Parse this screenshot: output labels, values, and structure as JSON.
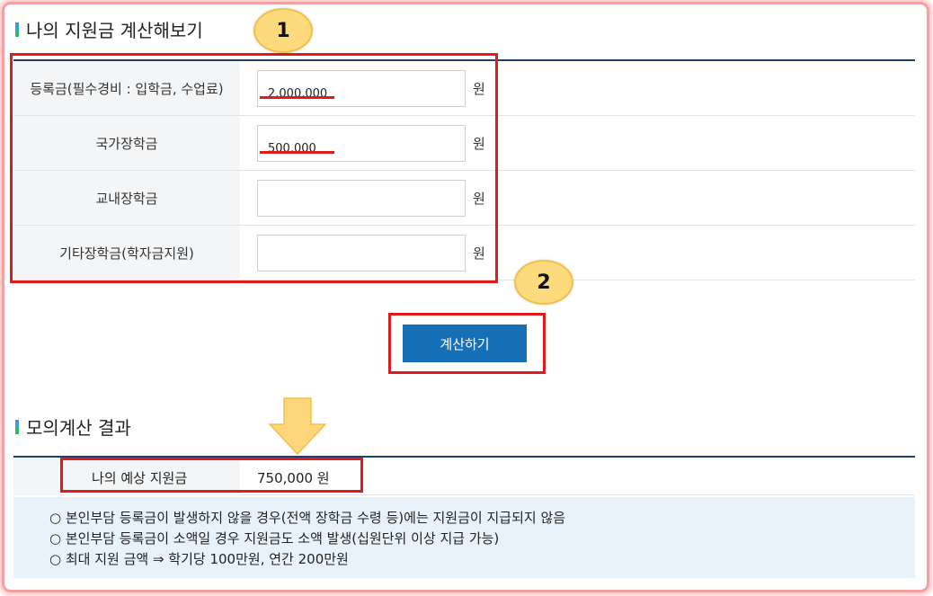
{
  "calculator": {
    "title": "나의 지원금 계산해보기",
    "rows": [
      {
        "label": "등록금(필수경비 : 입학금, 수업료)",
        "value": "2,000,000",
        "unit": "원"
      },
      {
        "label": "국가장학금",
        "value": "500,000",
        "unit": "원"
      },
      {
        "label": "교내장학금",
        "value": "",
        "unit": "원"
      },
      {
        "label": "기타장학금(학자금지원)",
        "value": "",
        "unit": "원"
      }
    ],
    "calculate_button": "계산하기"
  },
  "annotations": {
    "step1": "1",
    "step2": "2",
    "highlight_color": "#e01b1b",
    "badge_color": "#fddb7c"
  },
  "result": {
    "title": "모의계산 결과",
    "label": "나의 예상 지원금",
    "value": "750,000 원",
    "notes": [
      "○ 본인부담 등록금이 발생하지 않을 경우(전액 장학금 수령 등)에는 지원금이 지급되지 않음",
      "○ 본인부담 등록금이 소액일 경우 지원금도 소액 발생(십원단위 이상 지급 가능)",
      "○ 최대 지원 금액 ⇒ 학기당 100만원, 연간 200만원"
    ]
  },
  "colors": {
    "button": "#1670b8",
    "header_rule": "#1f3f6e",
    "notes_bg": "#e8f2fb"
  }
}
